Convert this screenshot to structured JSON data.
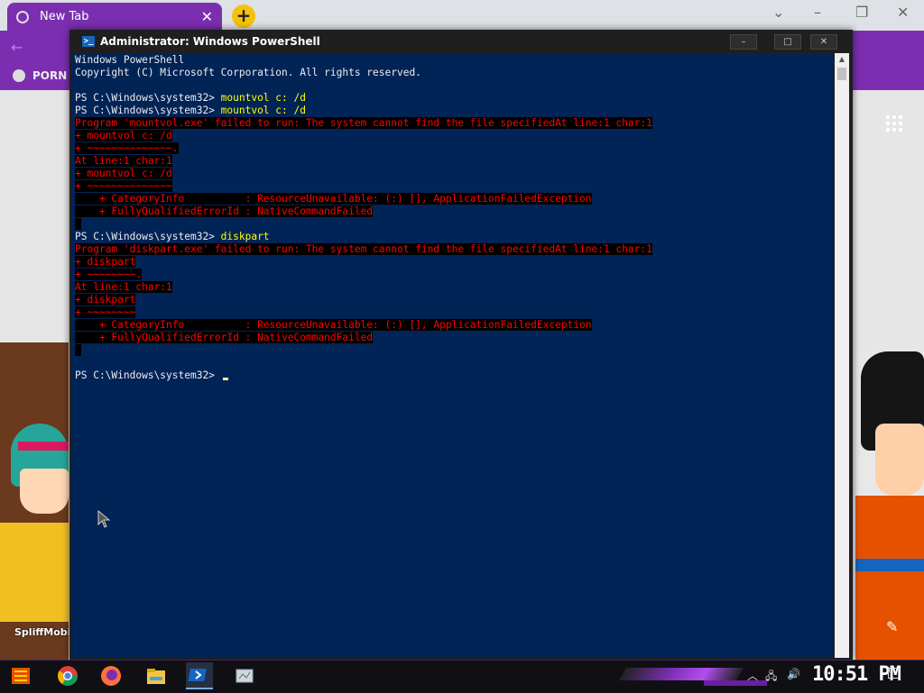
{
  "browser": {
    "tab_title": "New Tab",
    "tab_close": "✕",
    "new_tab": "+",
    "bookmark_label": "PORN",
    "watermark": "SpliffMobil"
  },
  "powershell": {
    "title": "Administrator: Windows PowerShell",
    "icon_glyph": ">_",
    "buttons": {
      "minimize": "–",
      "maximize": "□",
      "close": "✕"
    },
    "lines": [
      {
        "type": "text",
        "text": "Windows PowerShell"
      },
      {
        "type": "text",
        "text": "Copyright (C) Microsoft Corporation. All rights reserved."
      },
      {
        "type": "blank",
        "text": ""
      },
      {
        "type": "prompt",
        "prompt": "PS C:\\Windows\\system32> ",
        "cmd": "mountvol c: /d"
      },
      {
        "type": "prompt",
        "prompt": "PS C:\\Windows\\system32> ",
        "cmd": "mountvol c: /d"
      },
      {
        "type": "error",
        "text": "Program 'mountvol.exe' failed to run: The system cannot find the file specifiedAt line:1 char:1"
      },
      {
        "type": "error",
        "text": "+ mountvol c: /d"
      },
      {
        "type": "error",
        "text": "+ ~~~~~~~~~~~~~~."
      },
      {
        "type": "error",
        "text": "At line:1 char:1"
      },
      {
        "type": "error",
        "text": "+ mountvol c: /d"
      },
      {
        "type": "error",
        "text": "+ ~~~~~~~~~~~~~~"
      },
      {
        "type": "error",
        "text": "    + CategoryInfo          : ResourceUnavailable: (:) [], ApplicationFailedException"
      },
      {
        "type": "error",
        "text": "    + FullyQualifiedErrorId : NativeCommandFailed"
      },
      {
        "type": "error",
        "text": " "
      },
      {
        "type": "prompt",
        "prompt": "PS C:\\Windows\\system32> ",
        "cmd": "diskpart"
      },
      {
        "type": "error",
        "text": "Program 'diskpart.exe' failed to run: The system cannot find the file specifiedAt line:1 char:1"
      },
      {
        "type": "error",
        "text": "+ diskpart"
      },
      {
        "type": "error",
        "text": "+ ~~~~~~~~."
      },
      {
        "type": "error",
        "text": "At line:1 char:1"
      },
      {
        "type": "error",
        "text": "+ diskpart"
      },
      {
        "type": "error",
        "text": "+ ~~~~~~~~"
      },
      {
        "type": "error",
        "text": "    + CategoryInfo          : ResourceUnavailable: (:) [], ApplicationFailedException"
      },
      {
        "type": "error",
        "text": "    + FullyQualifiedErrorId : NativeCommandFailed"
      },
      {
        "type": "error",
        "text": " "
      },
      {
        "type": "blank",
        "text": ""
      },
      {
        "type": "current",
        "prompt": "PS C:\\Windows\\system32> ",
        "cmd": ""
      }
    ],
    "colors": {
      "background": "#012456",
      "text": "#eeedf0",
      "command": "#ffff00",
      "error": "#ff0000",
      "error_bg": "#000000"
    }
  },
  "taskbar": {
    "items": [
      "start-icon",
      "chrome-icon",
      "firefox-icon",
      "file-explorer-icon",
      "powershell-icon",
      "app-icon"
    ],
    "clock": "10:51 PM"
  }
}
